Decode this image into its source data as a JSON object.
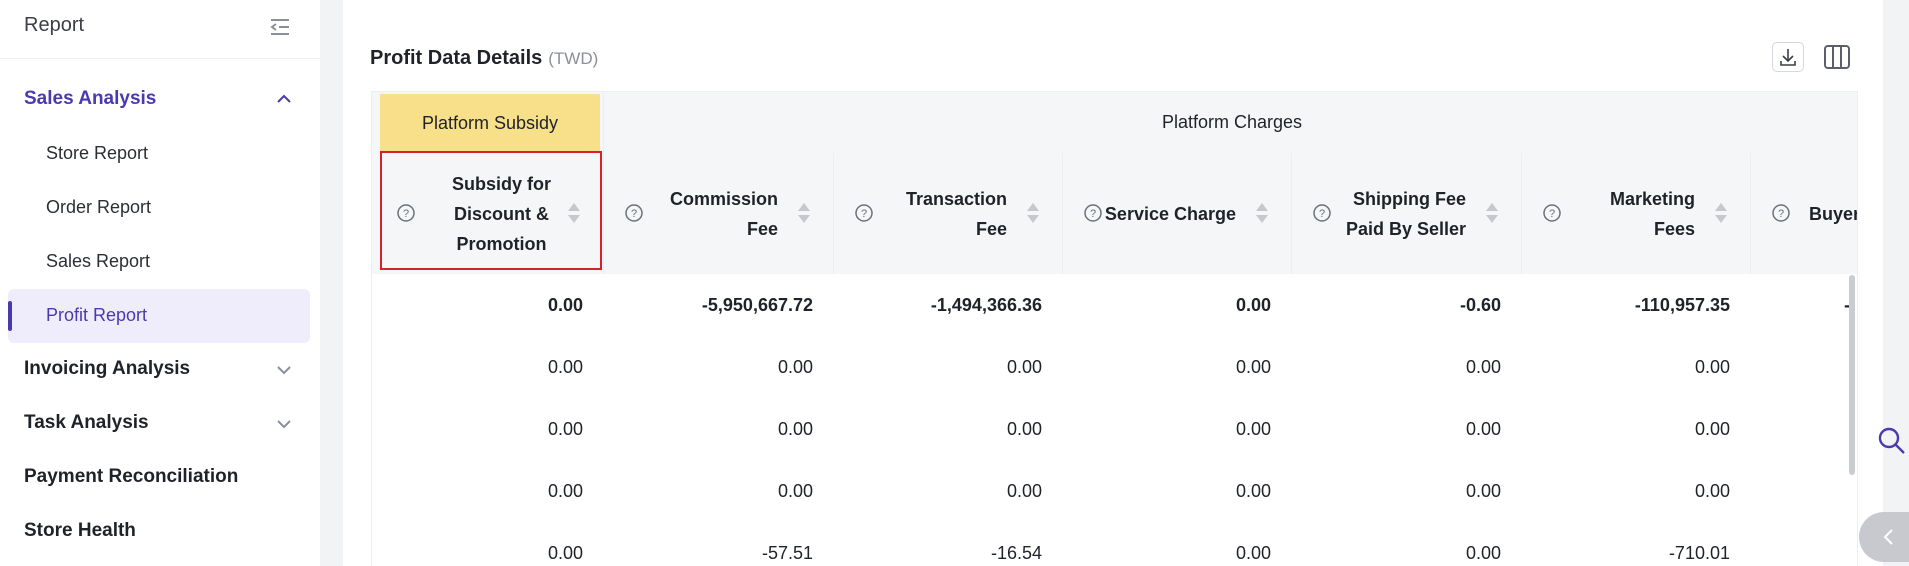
{
  "sidebar": {
    "title": "Report",
    "groups": [
      {
        "label": "Sales Analysis",
        "expanded": true
      },
      {
        "label": "Invoicing Analysis",
        "expanded": false
      },
      {
        "label": "Task Analysis",
        "expanded": false
      },
      {
        "label": "Payment Reconciliation"
      },
      {
        "label": "Store Health"
      }
    ],
    "sales_items": [
      "Store Report",
      "Order Report",
      "Sales Report",
      "Profit Report"
    ],
    "selected": "Profit Report"
  },
  "main": {
    "title": "Profit Data Details",
    "unit": "(TWD)",
    "group_headers": {
      "subsidy": "Platform Subsidy",
      "charges": "Platform Charges"
    },
    "columns": [
      {
        "line1": "Subsidy for",
        "line2": "Discount &",
        "line3": "Promotion"
      },
      {
        "line1": "Commission",
        "line2": "Fee"
      },
      {
        "line1": "Transaction",
        "line2": "Fee"
      },
      {
        "line1": "Service Charge"
      },
      {
        "line1": "Shipping Fee",
        "line2": "Paid By Seller"
      },
      {
        "line1": "Marketing",
        "line2": "Fees"
      },
      {
        "line1": "Buyer"
      }
    ],
    "rows": [
      [
        "0.00",
        "-5,950,667.72",
        "-1,494,366.36",
        "0.00",
        "-0.60",
        "-110,957.35",
        "-"
      ],
      [
        "0.00",
        "0.00",
        "0.00",
        "0.00",
        "0.00",
        "0.00",
        ""
      ],
      [
        "0.00",
        "0.00",
        "0.00",
        "0.00",
        "0.00",
        "0.00",
        ""
      ],
      [
        "0.00",
        "0.00",
        "0.00",
        "0.00",
        "0.00",
        "0.00",
        ""
      ],
      [
        "0.00",
        "-57.51",
        "-16.54",
        "0.00",
        "0.00",
        "-710.01",
        ""
      ]
    ]
  },
  "colors": {
    "accent": "#4a3ab0",
    "subsidy_header": "#f8df8a",
    "highlight_border": "#d9202a"
  },
  "icons": [
    "collapse-menu-icon",
    "chevron-up-icon",
    "chevron-down-icon",
    "download-icon",
    "columns-icon",
    "question-icon",
    "sort-icon",
    "search-icon",
    "chevron-left-icon"
  ]
}
